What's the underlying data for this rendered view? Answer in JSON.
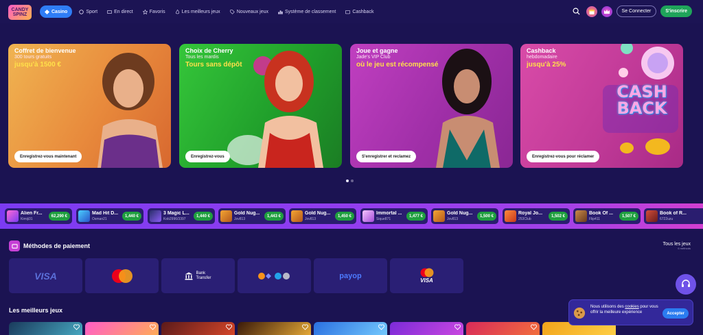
{
  "logo": {
    "text": "CANDY SPINZ"
  },
  "nav": [
    {
      "label": "Casino",
      "icon": "diamond-icon"
    },
    {
      "label": "Sport",
      "icon": "ball-icon"
    },
    {
      "label": "En direct",
      "icon": "live-icon"
    },
    {
      "label": "Favoris",
      "icon": "star-icon"
    },
    {
      "label": "Les meilleurs jeux",
      "icon": "flame-icon"
    },
    {
      "label": "Nouveaux jeux",
      "icon": "tag-icon"
    },
    {
      "label": "Système de classement",
      "icon": "ranking-icon"
    },
    {
      "label": "Cashback",
      "icon": "cashback-icon"
    }
  ],
  "header": {
    "login": "Se Connecter",
    "signup": "S'inscrire"
  },
  "hero": [
    {
      "title": "Coffret de bienvenue",
      "sub": "300 tours gratuits",
      "offer": "jusqu'à 1500 €",
      "button": "Enregistrez-vous maintenant"
    },
    {
      "title": "Choix de Cherry",
      "sub": "Tous les mardis",
      "offer": "Tours sans dépôt",
      "button": "Enregistrez-vous"
    },
    {
      "title": "Joue et gagne",
      "sub": "Jade's VIP Club",
      "offer": "où le jeu est récompensé",
      "button": "S'enregistrer et reclamez"
    },
    {
      "title": "Cashback",
      "sub": "hebdomadaire",
      "offer": "jusqu'à 25%",
      "button": "Enregistrez-vous pour réclamer"
    }
  ],
  "ticker": [
    {
      "name": "Alien Fr...",
      "user": "Kimiji31",
      "amount": "62,290 €"
    },
    {
      "name": "Mad Hit D...",
      "user": "Osman21",
      "amount": "1,440 €"
    },
    {
      "name": "3 Magic L...",
      "user": "Kob2996/3397",
      "amount": "1,440 €"
    },
    {
      "name": "Gold Nug...",
      "user": "Jov813",
      "amount": "1,443 €"
    },
    {
      "name": "Gold Nug...",
      "user": "Jov813",
      "amount": "1,450 €"
    },
    {
      "name": "Immortal ...",
      "user": "Sique871",
      "amount": "1,477 €"
    },
    {
      "name": "Gold Nug...",
      "user": "Jov813",
      "amount": "1,500 €"
    },
    {
      "name": "Royal Jo...",
      "user": "253Club",
      "amount": "1,502 €"
    },
    {
      "name": "Book Of ...",
      "user": "Flip411",
      "amount": "1,507 €"
    },
    {
      "name": "Book of R...",
      "user": "6722uzu",
      "amount": ""
    }
  ],
  "payments": {
    "title": "Méthodes de paiement",
    "all_label": "Tous les jeux",
    "all_sub": "6 méthods",
    "bank_line1": "Bank",
    "bank_line2": "Transfer",
    "visa": "VISA",
    "payop": "payop",
    "visa2": "VISA"
  },
  "best_games": {
    "title": "Les meilleurs jeux"
  },
  "cookie": {
    "text_before": "Nous utilisons des ",
    "link": "cookies",
    "text_after": " pour vous offrir la meilleure expérience",
    "button": "Accepter"
  },
  "colors": {
    "bg": "#1b1352",
    "accent": "#2f7df6",
    "green": "#1fa45a"
  }
}
